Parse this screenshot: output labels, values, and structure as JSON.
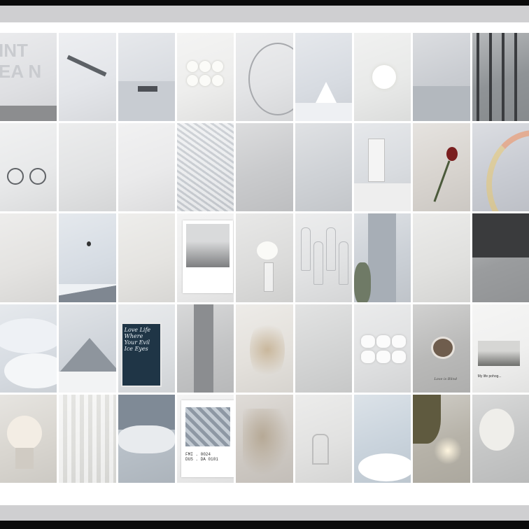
{
  "collage": {
    "rows": 5,
    "columns": 9,
    "tiles": [
      {
        "id": "r1c1",
        "desc": "white wall lettering",
        "tone": "#dfe0e3"
      },
      {
        "id": "r1c2",
        "desc": "airplane wing in pale sky",
        "tone": "#e4e6ea"
      },
      {
        "id": "r1c3",
        "desc": "small boat on calm sea",
        "tone": "#dadde2"
      },
      {
        "id": "r1c4",
        "desc": "white flower bouquet",
        "tone": "#eeeeed"
      },
      {
        "id": "r1c5",
        "desc": "white ferris wheel",
        "tone": "#e3e4e6"
      },
      {
        "id": "r1c6",
        "desc": "snowy tent landscape",
        "tone": "#d8dce2"
      },
      {
        "id": "r1c7",
        "desc": "white lily on water",
        "tone": "#e9eae9"
      },
      {
        "id": "r1c8",
        "desc": "grey sea horizon",
        "tone": "#c9ccd1"
      },
      {
        "id": "r1c9",
        "desc": "dark window frames",
        "tone": "#8f9396"
      },
      {
        "id": "r2c1",
        "desc": "white bicycle by wall",
        "tone": "#e8e9ea"
      },
      {
        "id": "r2c2",
        "desc": "leaf shadows on wall",
        "tone": "#e2e3e4"
      },
      {
        "id": "r2c3",
        "desc": "ferris wheel close-up",
        "tone": "#eaeaeb"
      },
      {
        "id": "r2c4",
        "desc": "snowy ground texture",
        "tone": "#d6d9dd"
      },
      {
        "id": "r2c5",
        "desc": "dried flowers and glass",
        "tone": "#c9cacc"
      },
      {
        "id": "r2c6",
        "desc": "white architecture shadows",
        "tone": "#cfd2d6"
      },
      {
        "id": "r2c7",
        "desc": "white church tower",
        "tone": "#d9dce0"
      },
      {
        "id": "r2c8",
        "desc": "red rose on open book",
        "tone": "#d8d4cf"
      },
      {
        "id": "r2c9",
        "desc": "rainbow in pale sky",
        "tone": "#c9ccd3"
      },
      {
        "id": "r3c1",
        "desc": "white net with dry flowers",
        "tone": "#e4e3e1"
      },
      {
        "id": "r3c2",
        "desc": "hot air balloon over snowy mountain",
        "tone": "#d7dde4"
      },
      {
        "id": "r3c3",
        "desc": "plant and round lamp",
        "tone": "#e5e4e1"
      },
      {
        "id": "r3c4",
        "desc": "polaroid of foggy field",
        "tone": "#eeeeee"
      },
      {
        "id": "r3c5",
        "desc": "white hydrangea in vase",
        "tone": "#dcdcdb"
      },
      {
        "id": "r3c6",
        "desc": "wine glasses",
        "tone": "#e2e3e4"
      },
      {
        "id": "r3c7",
        "desc": "city street with towers",
        "tone": "#cbd0d6"
      },
      {
        "id": "r3c8",
        "desc": "white desk with stationery",
        "tone": "#e1e1df"
      },
      {
        "id": "r3c9",
        "desc": "dark shelf with bottles",
        "tone": "#9a9c9e"
      },
      {
        "id": "r4c1",
        "desc": "fluffy white clouds",
        "tone": "#d8dde3"
      },
      {
        "id": "r4c2",
        "desc": "snow capped mountain",
        "tone": "#cfd4da"
      },
      {
        "id": "r4c3",
        "desc": "chalkboard sign",
        "tone": "#dde0e3"
      },
      {
        "id": "r4c4",
        "desc": "grey concrete architecture",
        "tone": "#c3c4c5"
      },
      {
        "id": "r4c5",
        "desc": "dried pampas flowers",
        "tone": "#e4e1dc"
      },
      {
        "id": "r4c6",
        "desc": "white table with ornaments",
        "tone": "#d3d4d4"
      },
      {
        "id": "r4c7",
        "desc": "white crystals",
        "tone": "#e0e1e2"
      },
      {
        "id": "r4c8",
        "desc": "coffee cup and notes",
        "tone": "#b9b9b8"
      },
      {
        "id": "r4c9",
        "desc": "card with landscape photo",
        "tone": "#f0f0ef"
      },
      {
        "id": "r5c1",
        "desc": "white flowers in vase",
        "tone": "#d9d6d0"
      },
      {
        "id": "r5c2",
        "desc": "sheer curtain with rose",
        "tone": "#e3e3e1"
      },
      {
        "id": "r5c3",
        "desc": "clouds over mountains",
        "tone": "#b7bfc7"
      },
      {
        "id": "r5c4",
        "desc": "polaroid of grey stones",
        "tone": "#eeeeee"
      },
      {
        "id": "r5c5",
        "desc": "pampas grass close-up",
        "tone": "#cfcac4"
      },
      {
        "id": "r5c6",
        "desc": "white chairs and plant",
        "tone": "#e2e2e1"
      },
      {
        "id": "r5c7",
        "desc": "clouds in blue sky",
        "tone": "#c9d3dc"
      },
      {
        "id": "r5c8",
        "desc": "autumn leaves and sunlight",
        "tone": "#b6b2a8"
      },
      {
        "id": "r5c9",
        "desc": "white flowers on table",
        "tone": "#c5c6c6"
      }
    ]
  },
  "texts": {
    "wall_letters_1": "INT",
    "wall_letters_2": "EA N",
    "chalkboard": [
      "Love Life",
      "Where",
      "Your Evil",
      "Ice Eyes"
    ],
    "polaroid_caption_1": "",
    "polaroid_caption_2": "FMI . 0024\nDUS . DA 0101",
    "card_caption": "My life pohog...",
    "desk_caption": "Love is Blind"
  },
  "colors": {
    "frame": "#0b0b0b",
    "band": "#cfcfd1",
    "background": "#ffffff"
  }
}
